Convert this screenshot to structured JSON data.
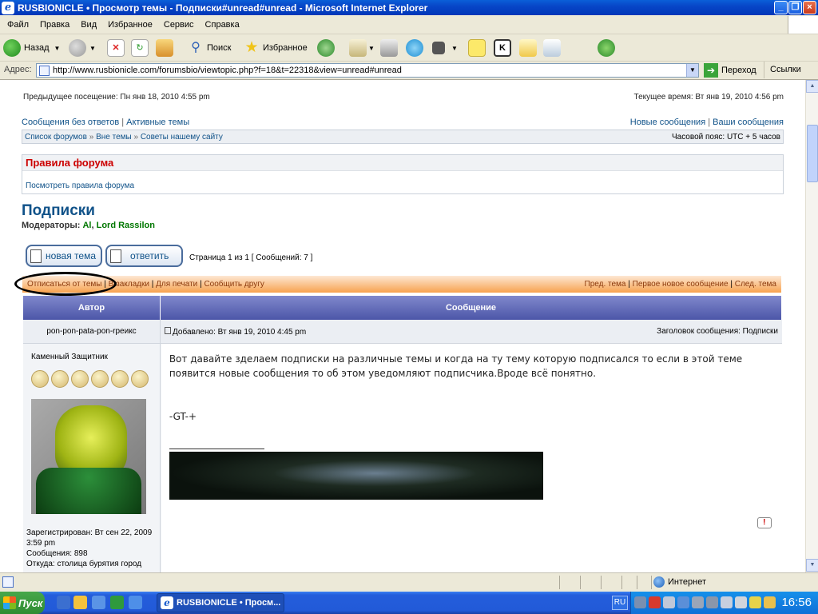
{
  "window": {
    "title": "RUSBIONICLE • Просмотр темы - Подписки#unread#unread - Microsoft Internet Explorer",
    "min_label": "_",
    "max_label": "❐",
    "close_label": "×"
  },
  "menu": [
    "Файл",
    "Правка",
    "Вид",
    "Избранное",
    "Сервис",
    "Справка"
  ],
  "toolbar": {
    "back_label": "Назад",
    "search_label": "Поиск",
    "favorites_label": "Избранное"
  },
  "address": {
    "label": "Адрес:",
    "url": "http://www.rusbionicle.com/forumsbio/viewtopic.php?f=18&t=22318&view=unread#unread",
    "go_label": "Переход",
    "links_label": "Ссылки"
  },
  "page": {
    "last_visit": "Предыдущее посещение: Пн янв 18, 2010 4:55 pm",
    "current_time": "Текущее время: Вт янв 19, 2010 4:56 pm",
    "unanswered": "Сообщения без ответов",
    "active": "Активные темы",
    "new_posts": "Новые сообщения",
    "your_posts": "Ваши сообщения",
    "bc_index": "Список форумов",
    "bc_offtopic": "Вне темы",
    "bc_advice": "Советы нашему сайту",
    "timezone": "Часовой пояс: UTC + 5 часов",
    "rules_title": "Правила форума",
    "rules_link": "Посмотреть правила форума",
    "forum_title": "Подписки",
    "moderators_label": "Модераторы:",
    "mod1": "Al",
    "mod2": "Lord Rassilon",
    "new_topic_btn": "новая тема",
    "reply_btn": "ответить",
    "page_info": "Страница 1 из 1   [ Сообщений: 7 ]",
    "unsubscribe": "Отписаться от темы",
    "bookmarks": "В закладки",
    "print": "Для печати",
    "email_friend": "Сообщить другу",
    "prev_topic": "Пред. тема",
    "first_new": "Первое новое сообщение",
    "next_topic": "След. тема",
    "col_author": "Автор",
    "col_message": "Сообщение"
  },
  "post": {
    "author": "pon-pon-pata-pon-rpeикс",
    "posted": "Добавлено: Вт янв 19, 2010 4:45 pm",
    "subject": "Заголовок сообщения: Подписки",
    "rank": "Каменный Защитник",
    "body": "Вот давайте зделаем подписки на различные темы и когда на ту тему которую подписался то если в этой теме появится новые сообщения то об этом уведомляют подписчика.Вроде всё понятно.",
    "signature": "-GT-+",
    "registered": "Зарегистрирован: Вт сен 22, 2009 3:59 pm",
    "posts": "Сообщения: 898",
    "from": "Откуда: столица бурятия город",
    "report_label": "!"
  },
  "status": {
    "zone": "Интернет"
  },
  "taskbar": {
    "start": "Пуск",
    "task": "RUSBIONICLE • Просм...",
    "lang": "RU",
    "clock": "16:56"
  }
}
